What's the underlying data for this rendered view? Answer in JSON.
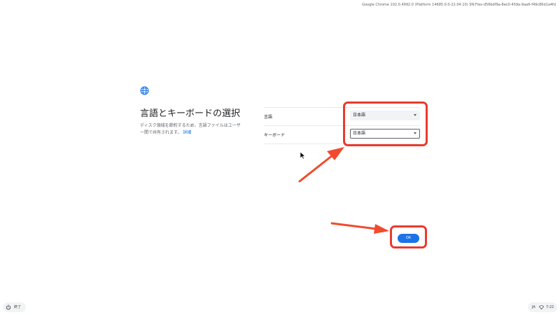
{
  "system": {
    "version": "Google Chrome 102.0.4992.0 (Platform 14685.0.0-22.04.10) SN:Flex-d56bdf9a-8ec0-459a-9aa6-f49c86d1a4fd"
  },
  "dialog": {
    "icon": "globe-icon",
    "title": "言語とキーボードの選択",
    "description": "ディスク領域を節約するため、言語ファイルはユーザー間で共有されます。",
    "details_link": "詳細",
    "language_label": "言語",
    "language_value": "日本語",
    "keyboard_label": "キーボード",
    "keyboard_value": "日本語",
    "ok_button": "OK"
  },
  "shelf": {
    "shutdown_icon": "power-icon",
    "shutdown_label": "終了",
    "ime": "JA",
    "wifi_icon": "wifi-icon",
    "time": "7:22"
  },
  "annotations": {
    "highlight_color": "#ea3a2d"
  },
  "colors": {
    "accent": "#1a73e8",
    "text": "#202124",
    "secondary_text": "#5f6368",
    "divider": "#e8eaed"
  }
}
